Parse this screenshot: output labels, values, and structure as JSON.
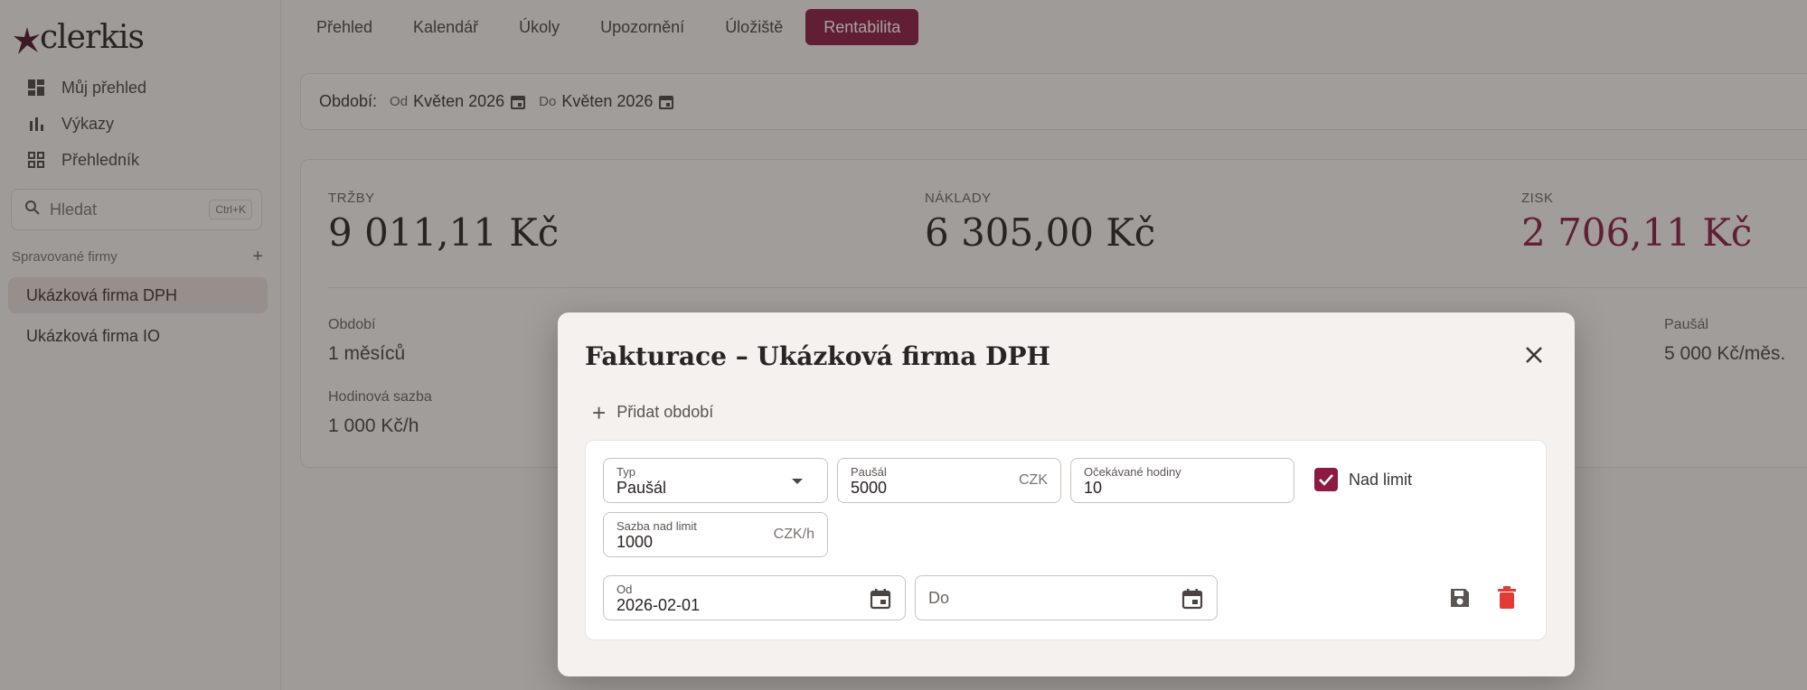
{
  "app": {
    "logo_text": "clerkis"
  },
  "sidebar": {
    "nav": [
      {
        "label": "Můj přehled",
        "icon": "dashboard-icon"
      },
      {
        "label": "Výkazy",
        "icon": "bar-chart-icon"
      },
      {
        "label": "Přehledník",
        "icon": "grid-icon"
      }
    ],
    "search": {
      "label": "Hledat",
      "shortcut": "Ctrl+K"
    },
    "companies_header": "Spravované firmy",
    "companies": [
      {
        "label": "Ukázková firma DPH",
        "active": true
      },
      {
        "label": "Ukázková firma IO",
        "active": false
      }
    ]
  },
  "tabs": [
    {
      "label": "Přehled"
    },
    {
      "label": "Kalendář"
    },
    {
      "label": "Úkoly"
    },
    {
      "label": "Upozornění"
    },
    {
      "label": "Úložiště"
    },
    {
      "label": "Rentabilita",
      "active": true
    }
  ],
  "period": {
    "label": "Období:",
    "from_label": "Od",
    "from_value": "Květen 2026",
    "to_label": "Do",
    "to_value": "Květen 2026"
  },
  "stats": {
    "revenue": {
      "label": "TRŽBY",
      "value": "9 011,11 Kč"
    },
    "costs": {
      "label": "NÁKLADY",
      "value": "6 305,00 Kč"
    },
    "profit": {
      "label": "ZISK",
      "value": "2 706,11 Kč"
    },
    "period": {
      "label": "Období",
      "value": "1 měsíců"
    },
    "hourly_rate": {
      "label": "Hodinová sazba",
      "value": "1 000 Kč/h"
    },
    "flat_fee": {
      "label": "Paušál",
      "value": "5 000 Kč/měs."
    }
  },
  "modal": {
    "title": "Fakturace – Ukázková firma DPH",
    "add_period": "Přidat období",
    "type": {
      "label": "Typ",
      "value": "Paušál"
    },
    "flat_fee": {
      "label": "Paušál",
      "value": "5000",
      "suffix": "CZK"
    },
    "expected_hours": {
      "label": "Očekávané hodiny",
      "value": "10"
    },
    "over_limit": {
      "label": "Nad limit",
      "checked": true
    },
    "over_limit_rate": {
      "label": "Sazba nad limit",
      "value": "1000",
      "suffix": "CZK/h"
    },
    "from": {
      "label": "Od",
      "value": "2026-02-01"
    },
    "to": {
      "placeholder": "Do"
    }
  },
  "colors": {
    "accent": "#8c1a43",
    "delete": "#e53935"
  }
}
